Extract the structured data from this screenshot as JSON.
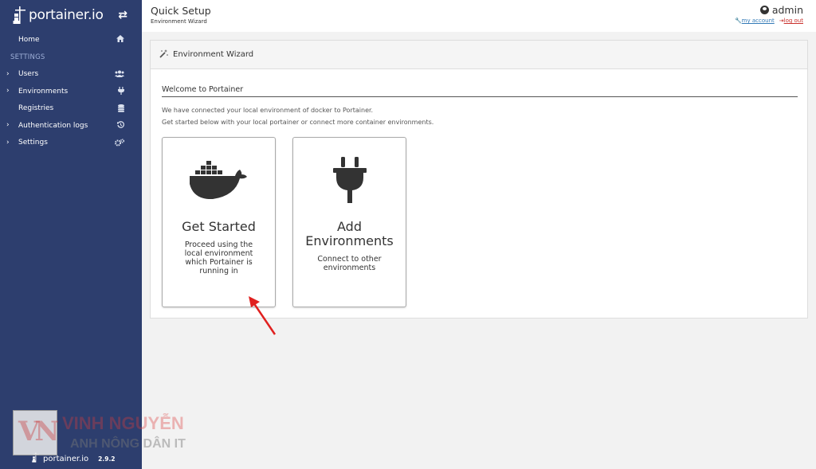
{
  "sidebar": {
    "logo_text": "portainer.io",
    "section_settings": "SETTINGS",
    "items": [
      {
        "label": "Home",
        "icon": "home-icon"
      },
      {
        "label": "Users",
        "icon": "users-icon"
      },
      {
        "label": "Environments",
        "icon": "plug-icon"
      },
      {
        "label": "Registries",
        "icon": "database-icon"
      },
      {
        "label": "Authentication logs",
        "icon": "history-icon"
      },
      {
        "label": "Settings",
        "icon": "cogs-icon"
      }
    ],
    "footer_logo": "portainer.io",
    "version": "2.9.2"
  },
  "header": {
    "title": "Quick Setup",
    "subtitle": "Environment Wizard",
    "username": "admin",
    "my_account": "my account",
    "log_out": "log out"
  },
  "panel": {
    "title": "Environment Wizard",
    "welcome": "Welcome to Portainer",
    "desc_line1": "We have connected your local environment of docker to Portainer.",
    "desc_line2": "Get started below with your local portainer or connect more container environments."
  },
  "cards": {
    "get_started": {
      "title": "Get Started",
      "desc_lines": [
        "Proceed using the",
        "local environment",
        "which Portainer is",
        "running in"
      ]
    },
    "add_env": {
      "title_lines": [
        "Add",
        "Environments"
      ],
      "desc_lines": [
        "Connect to other",
        "environments"
      ]
    }
  },
  "watermark": {
    "logo": "VN",
    "line1": "VINH NGUYỄN",
    "line2": "ANH NÔNG DÂN IT"
  },
  "colors": {
    "sidebar_bg": "#2d3e6e",
    "arrow": "#e0201f",
    "link": "#337ab7",
    "logout": "#c9302c"
  }
}
